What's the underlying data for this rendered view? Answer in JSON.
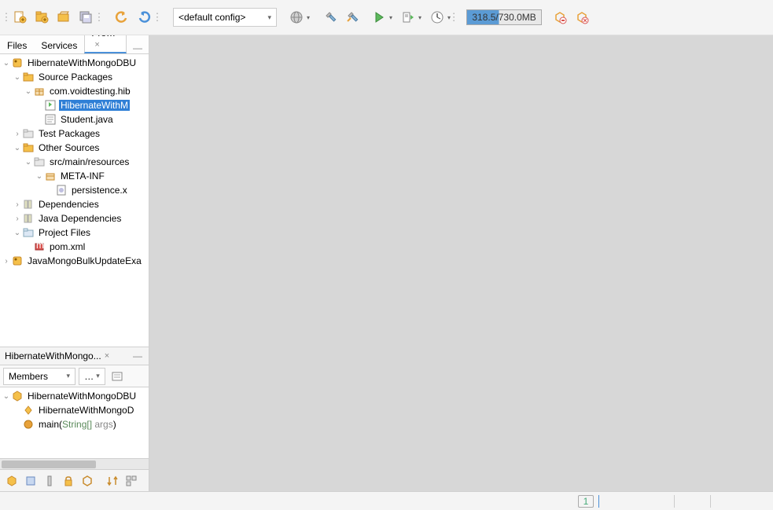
{
  "toolbar": {
    "config_selected": "<default config>",
    "memory": "318.5/730.0MB"
  },
  "sideTabs": {
    "files": "Files",
    "services": "Services",
    "projects": "Pro…"
  },
  "projectTree": {
    "root1": "HibernateWithMongoDBU",
    "src_packages": "Source Packages",
    "pkg": "com.voidtesting.hib",
    "file_sel": "HibernateWithM",
    "file_student": "Student.java",
    "test_packages": "Test Packages",
    "other_sources": "Other Sources",
    "src_res": "src/main/resources",
    "meta_inf": "META-INF",
    "persistence": "persistence.x",
    "deps": "Dependencies",
    "java_deps": "Java Dependencies",
    "proj_files": "Project Files",
    "pom": "pom.xml",
    "root2": "JavaMongoBulkUpdateExa"
  },
  "navigator": {
    "tab_title": "HibernateWithMongo...",
    "members": "Members",
    "class": "HibernateWithMongoDBU",
    "ctor": "HibernateWithMongoD",
    "main": "main",
    "main_param_type": "String[]",
    "main_param_name": " args"
  },
  "status": {
    "indicator": "1"
  }
}
